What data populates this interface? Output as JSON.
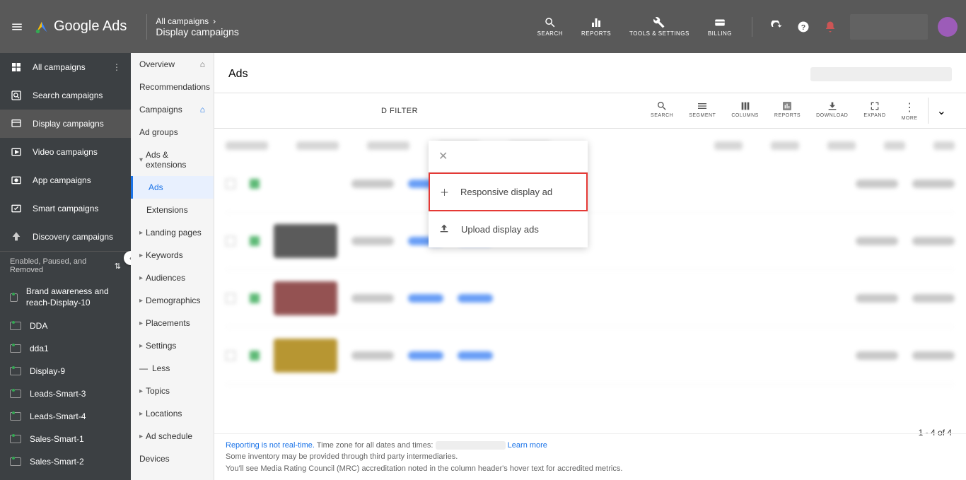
{
  "header": {
    "product": "Google Ads",
    "breadcrumb_top": "All campaigns",
    "breadcrumb_main": "Display campaigns",
    "tools": {
      "search": "SEARCH",
      "reports": "REPORTS",
      "tools_settings": "TOOLS & SETTINGS",
      "billing": "BILLING"
    }
  },
  "nav1": {
    "items": [
      {
        "label": "All campaigns"
      },
      {
        "label": "Search campaigns"
      },
      {
        "label": "Display campaigns"
      },
      {
        "label": "Video campaigns"
      },
      {
        "label": "App campaigns"
      },
      {
        "label": "Smart campaigns"
      },
      {
        "label": "Discovery campaigns"
      }
    ],
    "status": "Enabled, Paused, and Removed",
    "campaigns": [
      {
        "label": "Brand awareness and reach-Display-10"
      },
      {
        "label": "DDA"
      },
      {
        "label": "dda1"
      },
      {
        "label": "Display-9"
      },
      {
        "label": "Leads-Smart-3"
      },
      {
        "label": "Leads-Smart-4"
      },
      {
        "label": "Sales-Smart-1"
      },
      {
        "label": "Sales-Smart-2"
      }
    ]
  },
  "nav2": {
    "overview": "Overview",
    "recommendations": "Recommendations",
    "campaigns": "Campaigns",
    "ad_groups": "Ad groups",
    "ads_extensions": "Ads & extensions",
    "ads": "Ads",
    "extensions": "Extensions",
    "landing_pages": "Landing pages",
    "keywords": "Keywords",
    "audiences": "Audiences",
    "demographics": "Demographics",
    "placements": "Placements",
    "settings": "Settings",
    "less": "Less",
    "topics": "Topics",
    "locations": "Locations",
    "ad_schedule": "Ad schedule",
    "devices": "Devices"
  },
  "content": {
    "title": "Ads",
    "filter_label": "D FILTER",
    "toolbar": {
      "search": "SEARCH",
      "segment": "SEGMENT",
      "columns": "COLUMNS",
      "reports": "REPORTS",
      "download": "DOWNLOAD",
      "expand": "EXPAND",
      "more": "MORE"
    },
    "pagination": "1 - 4 of 4",
    "footer": {
      "line1a": "Reporting is not real-time.",
      "line1b": " Time zone for all dates and times: ",
      "learn_more": "Learn more",
      "line2": "Some inventory may be provided through third party intermediaries.",
      "line3": "You'll see Media Rating Council (MRC) accreditation noted in the column header's hover text for accredited metrics."
    }
  },
  "ad_menu": {
    "responsive": "Responsive display ad",
    "upload": "Upload display ads"
  }
}
